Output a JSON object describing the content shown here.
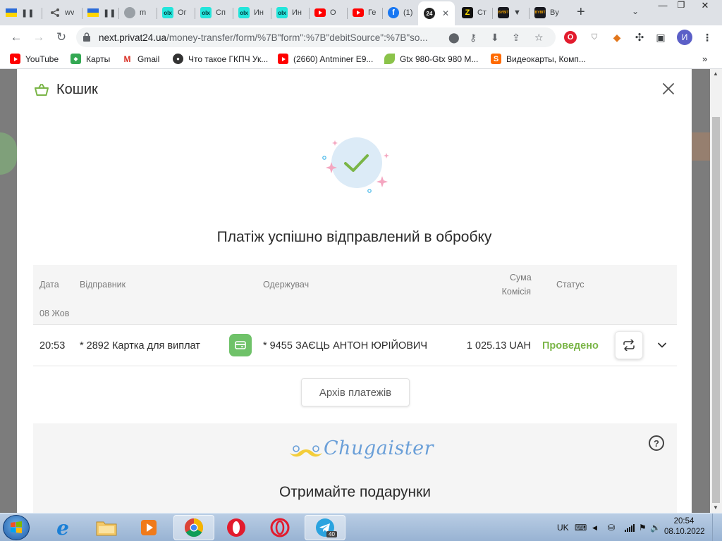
{
  "browser": {
    "tabs": [
      {
        "title": "",
        "icon": "ukraine-flag-pause"
      },
      {
        "title": "wv",
        "icon": "share-icon"
      },
      {
        "title": "",
        "icon": "ukraine-flag-pause"
      },
      {
        "title": "m",
        "icon": "globe-icon"
      },
      {
        "title": "Ог",
        "icon": "olx-icon"
      },
      {
        "title": "Сп",
        "icon": "olx-icon"
      },
      {
        "title": "Ин",
        "icon": "olx-icon"
      },
      {
        "title": "Ин",
        "icon": "olx-icon"
      },
      {
        "title": "О",
        "icon": "youtube-icon"
      },
      {
        "title": "Ге",
        "icon": "youtube-icon"
      },
      {
        "title": "(1)",
        "icon": "facebook-icon"
      },
      {
        "title": "",
        "icon": "privat24-icon",
        "active": true
      },
      {
        "title": "Ст",
        "icon": "zap-icon"
      },
      {
        "title": "",
        "icon": "bybit-icon"
      },
      {
        "title": "By",
        "icon": "bybit-icon"
      }
    ],
    "tab_favicon_text": {
      "olx": "olx",
      "privat": "24",
      "bybit": "BYBIT"
    },
    "url_host": "next.privat24.ua",
    "url_path": "/money-transfer/form/%7B\"form\":%7B\"debitSource\":%7B\"so...",
    "profile_initial": "И",
    "bookmarks": [
      {
        "label": "YouTube",
        "icon": "youtube-icon"
      },
      {
        "label": "Карты",
        "icon": "maps-icon"
      },
      {
        "label": "Gmail",
        "icon": "gmail-icon"
      },
      {
        "label": "Что такое ГКПЧ Ук...",
        "icon": "site-icon"
      },
      {
        "label": "(2660) Antminer E9...",
        "icon": "youtube-icon"
      },
      {
        "label": "Gtx 980-Gtx 980 M...",
        "icon": "leaf-icon"
      },
      {
        "label": "Видеокарты, Комп...",
        "icon": "s-icon"
      }
    ],
    "bookmark_icon_text": {
      "maps": "◆",
      "gmail": "M",
      "site": "●",
      "s": "S"
    }
  },
  "modal": {
    "title": "Кошик",
    "success_message": "Платіж успішно відправлений в обробку",
    "table": {
      "headers": {
        "date": "Дата",
        "sender": "Відправник",
        "recipient": "Одержувач",
        "amount": "Сума",
        "commission": "Комісія",
        "status": "Статус"
      },
      "group_date": "08 Жов",
      "rows": [
        {
          "time": "20:53",
          "sender": "* 2892 Картка для виплат",
          "recipient": "* 9455 ЗАЄЦЬ АНТОН ЮРІЙОВИЧ",
          "amount": "1 025.13 UAH",
          "status": "Проведено"
        }
      ]
    },
    "archive_button": "Архів платежів",
    "promo": {
      "brand": "Chugaister",
      "title": "Отримайте подарунки",
      "help_glyph": "?"
    }
  },
  "taskbar": {
    "language": "UK",
    "time": "20:54",
    "date": "08.10.2022",
    "telegram_badge": "40"
  },
  "colors": {
    "privat_green": "#7ab547",
    "check_circle": "#dcebf7",
    "chip_green": "#6fc269",
    "promo_blue": "#6a9fd8"
  }
}
